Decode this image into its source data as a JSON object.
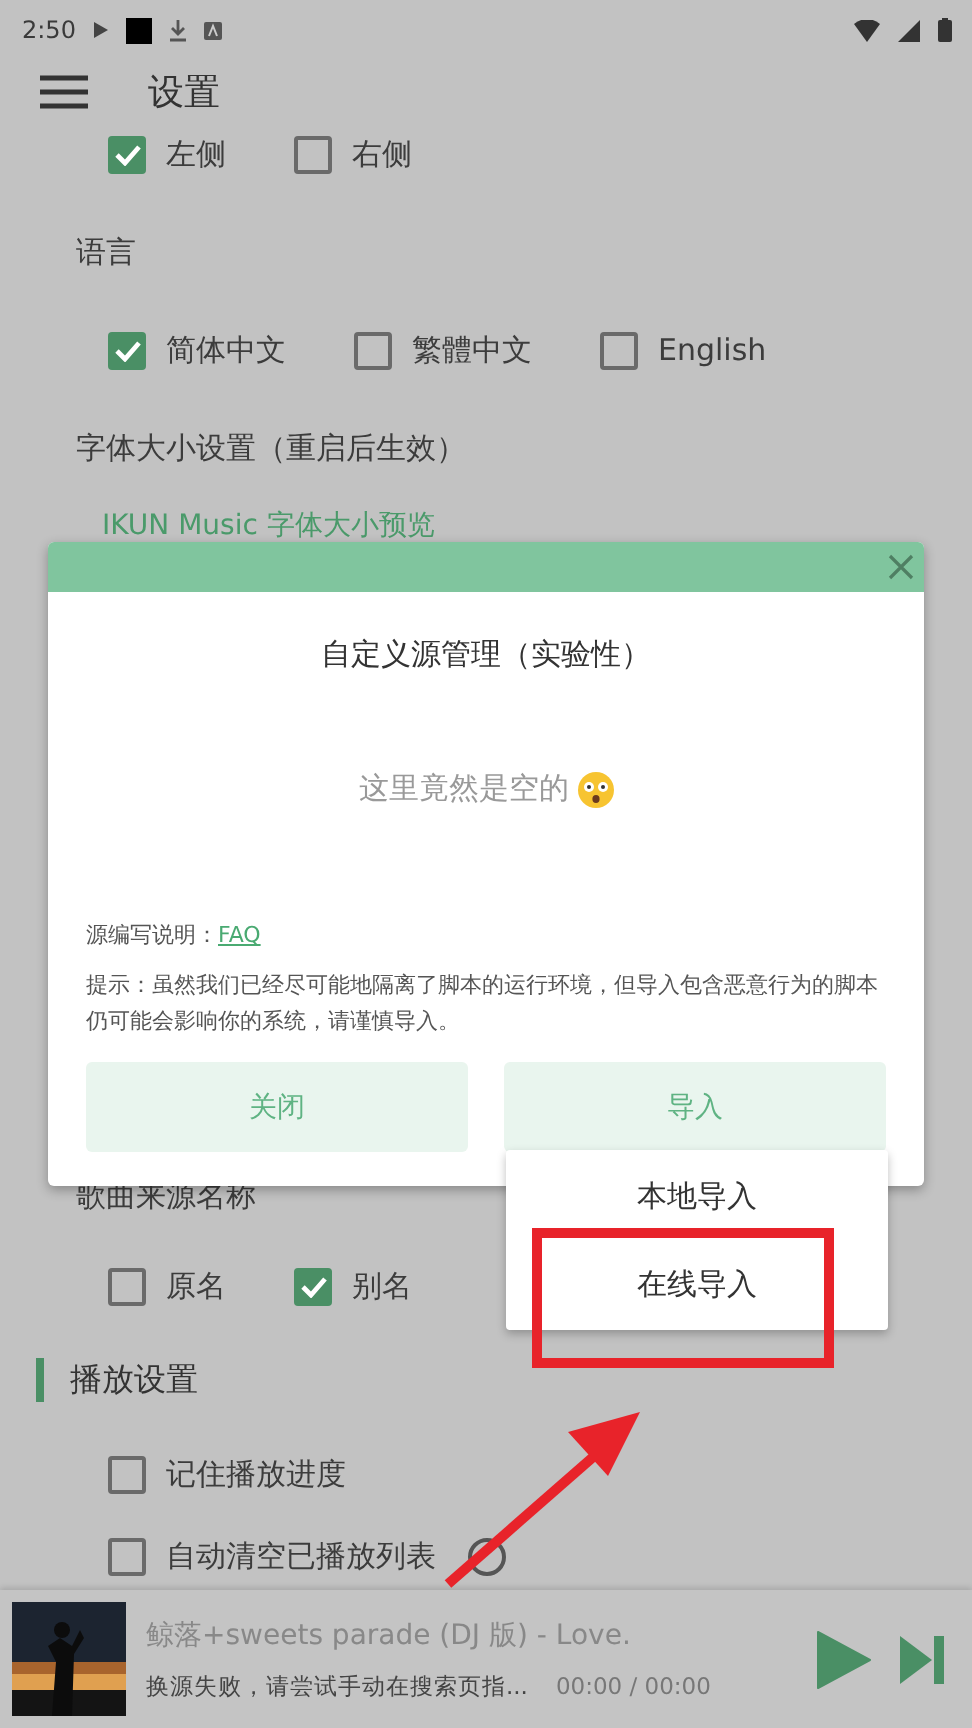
{
  "status_bar": {
    "time": "2:50"
  },
  "app_bar": {
    "title": "设置"
  },
  "settings_top": [
    {
      "kind": "options",
      "options": [
        {
          "label": "左侧",
          "checked": true
        },
        {
          "label": "右侧",
          "checked": false
        }
      ]
    },
    {
      "kind": "label",
      "text": "语言"
    },
    {
      "kind": "options",
      "options": [
        {
          "label": "简体中文",
          "checked": true
        },
        {
          "label": "繁體中文",
          "checked": false
        },
        {
          "label": "English",
          "checked": false
        }
      ]
    },
    {
      "kind": "label",
      "text": "字体大小设置（重启后生效）"
    },
    {
      "kind": "preview",
      "text": "IKUN Music 字体大小预览"
    }
  ],
  "settings_bottom": [
    {
      "kind": "label",
      "text": "歌曲来源名称"
    },
    {
      "kind": "options",
      "options": [
        {
          "label": "原名",
          "checked": false
        },
        {
          "label": "别名",
          "checked": true
        }
      ]
    },
    {
      "kind": "section",
      "text": "播放设置"
    },
    {
      "kind": "options",
      "options": [
        {
          "label": "记住播放进度",
          "checked": false
        }
      ]
    },
    {
      "kind": "options",
      "options": [
        {
          "label": "自动清空已播放列表",
          "checked": false,
          "help": true
        }
      ]
    }
  ],
  "dialog": {
    "title": "自定义源管理（实验性）",
    "empty_text": "这里竟然是空的",
    "note_label": "源编写说明：",
    "note_link": "FAQ",
    "hint": "提示：虽然我们已经尽可能地隔离了脚本的运行环境，但导入包含恶意行为的脚本仍可能会影响你的系统，请谨慎导入。",
    "buttons": [
      "关闭",
      "导入"
    ]
  },
  "import_menu": {
    "items": [
      {
        "label": "本地导入"
      },
      {
        "label": "在线导入"
      }
    ]
  },
  "player": {
    "title": "鲸落+sweets parade (DJ 版) - Love.",
    "status": "换源失败，请尝试手动在搜索页指...",
    "time": "00:00 / 00:00"
  }
}
